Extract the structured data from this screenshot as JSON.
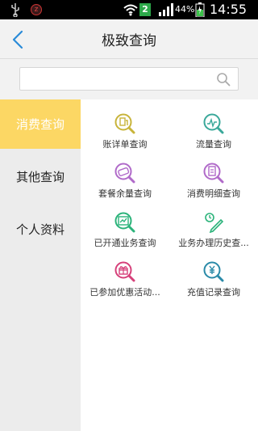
{
  "status_bar": {
    "sim_number": "2",
    "battery_percent": "44%",
    "time": "14:55",
    "icons": [
      "usb-icon",
      "notification-z-icon",
      "wifi-icon",
      "sim-icon",
      "signal-icon",
      "battery-icon"
    ]
  },
  "header": {
    "title": "极致查询",
    "back_icon": "back-arrow-icon"
  },
  "search": {
    "value": "",
    "placeholder": "",
    "icon": "search-icon"
  },
  "sidebar": {
    "items": [
      {
        "label": "消费查询",
        "active": true
      },
      {
        "label": "其他查询",
        "active": false
      },
      {
        "label": "个人资料",
        "active": false
      }
    ]
  },
  "grid": {
    "items": [
      {
        "label": "账详单查询",
        "icon": "bill-detail-icon",
        "color": "#c8b43a"
      },
      {
        "label": "流量查询",
        "icon": "gprs-data-icon",
        "color": "#3aa89a"
      },
      {
        "label": "套餐余量查询",
        "icon": "package-balance-icon",
        "color": "#b06ac9"
      },
      {
        "label": "消费明细查询",
        "icon": "consumption-detail-icon",
        "color": "#b06ac9"
      },
      {
        "label": "已开通业务查询",
        "icon": "opened-service-icon",
        "color": "#2bb37a"
      },
      {
        "label": "业务办理历史查...",
        "icon": "history-icon",
        "color": "#2bb37a"
      },
      {
        "label": "已参加优惠活动...",
        "icon": "gift-icon",
        "color": "#d6407a"
      },
      {
        "label": "充值记录查询",
        "icon": "recharge-record-icon",
        "color": "#2a8aa8"
      }
    ]
  }
}
